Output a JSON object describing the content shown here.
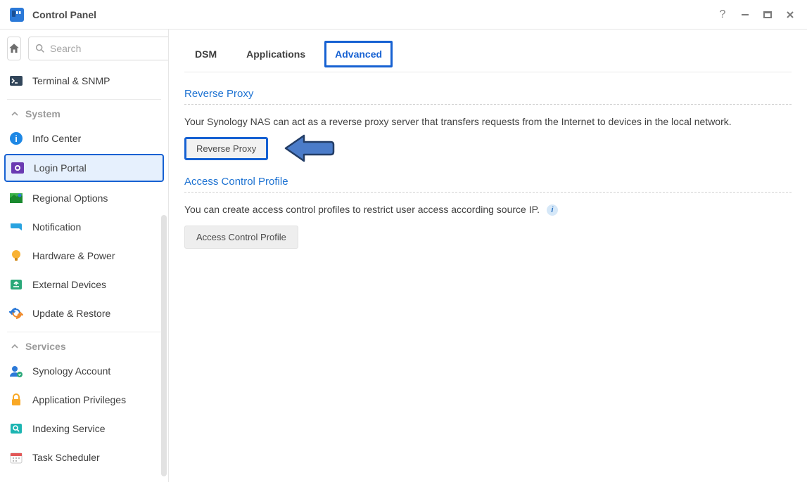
{
  "window": {
    "title": "Control Panel"
  },
  "search": {
    "placeholder": "Search",
    "value": ""
  },
  "sidebar": {
    "top_item": {
      "label": "Terminal & SNMP"
    },
    "groups": [
      {
        "label": "System",
        "items": [
          {
            "label": "Info Center"
          },
          {
            "label": "Login Portal",
            "selected": true
          },
          {
            "label": "Regional Options"
          },
          {
            "label": "Notification"
          },
          {
            "label": "Hardware & Power"
          },
          {
            "label": "External Devices"
          },
          {
            "label": "Update & Restore"
          }
        ]
      },
      {
        "label": "Services",
        "items": [
          {
            "label": "Synology Account"
          },
          {
            "label": "Application Privileges"
          },
          {
            "label": "Indexing Service"
          },
          {
            "label": "Task Scheduler"
          }
        ]
      }
    ]
  },
  "tabs": {
    "items": [
      {
        "label": "DSM"
      },
      {
        "label": "Applications"
      },
      {
        "label": "Advanced",
        "active": true
      }
    ]
  },
  "sections": {
    "reverse_proxy": {
      "title": "Reverse Proxy",
      "desc": "Your Synology NAS can act as a reverse proxy server that transfers requests from the Internet to devices in the local network.",
      "button": "Reverse Proxy"
    },
    "access_control": {
      "title": "Access Control Profile",
      "desc": "You can create access control profiles to restrict user access according source IP.",
      "button": "Access Control Profile"
    }
  }
}
